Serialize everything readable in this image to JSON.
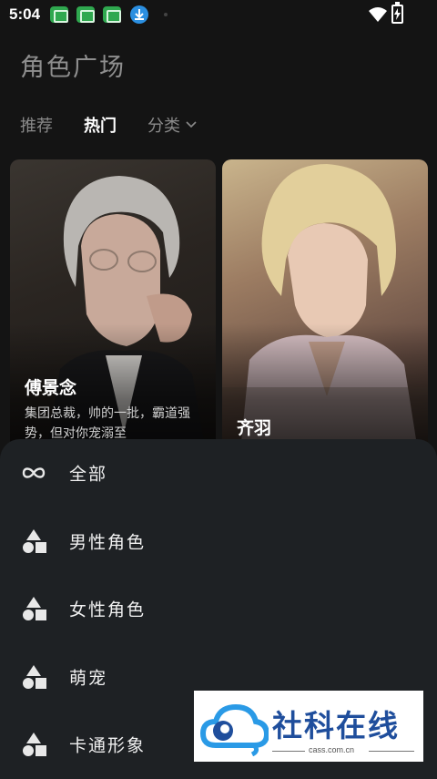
{
  "status_bar": {
    "time": "5:04",
    "icons": [
      "notification-app-icon",
      "notification-app-icon",
      "notification-app-icon",
      "download-icon",
      "wifi-icon",
      "battery-charging-icon"
    ]
  },
  "header": {
    "title": "角色广场",
    "tabs": [
      {
        "label": "推荐",
        "active": false
      },
      {
        "label": "热门",
        "active": true
      },
      {
        "label": "分类",
        "active": false,
        "icon": "chevron-down-icon"
      }
    ]
  },
  "cards": [
    {
      "name": "傅景念",
      "description": "集团总裁，帅的一批，霸道强势，但对你宠溺至"
    },
    {
      "name": "齐羽",
      "description": ""
    }
  ],
  "category_sheet": {
    "items": [
      {
        "label": "全部",
        "icon": "infinity-icon"
      },
      {
        "label": "男性角色",
        "icon": "shapes-icon"
      },
      {
        "label": "女性角色",
        "icon": "shapes-icon"
      },
      {
        "label": "萌宠",
        "icon": "shapes-icon"
      },
      {
        "label": "卡通形象",
        "icon": "shapes-icon"
      }
    ]
  },
  "watermark": {
    "text": "社科在线",
    "url": "cass.com.cn"
  },
  "colors": {
    "background": "#141414",
    "sheet": "#1e2124",
    "accent_text": "#ffffff",
    "muted_text": "#8a8a8a",
    "watermark_blue": "#1f4e9c"
  }
}
